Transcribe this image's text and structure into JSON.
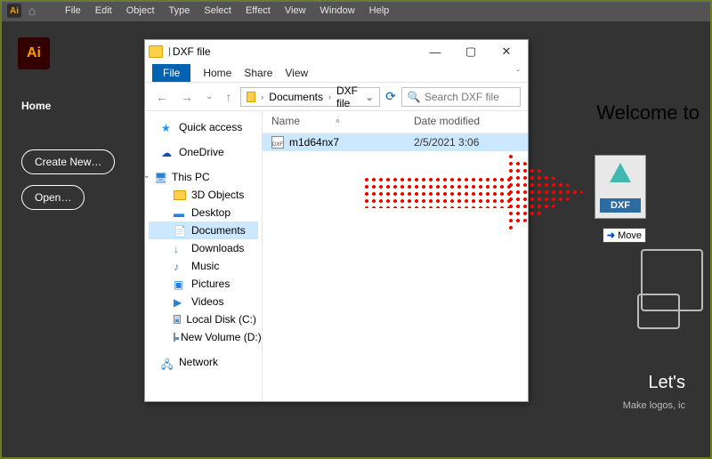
{
  "illustrator": {
    "brand_mark": "Ai",
    "menu": [
      "File",
      "Edit",
      "Object",
      "Type",
      "Select",
      "Effect",
      "View",
      "Window",
      "Help"
    ],
    "home_label": "Home",
    "create_new": "Create New…",
    "open": "Open…",
    "welcome": "Welcome to",
    "lets": "Let's",
    "subtitle": "Make logos, ic"
  },
  "drop_target": {
    "ext_label": "DXF",
    "tooltip_arrow": "➜",
    "tooltip_text": "Move"
  },
  "explorer": {
    "window_title": "DXF file",
    "ribbon": {
      "file": "File",
      "home": "Home",
      "share": "Share",
      "view": "View"
    },
    "breadcrumb": {
      "documents": "Documents",
      "folder": "DXF file"
    },
    "search_placeholder": "Search DXF file",
    "nav": {
      "quick_access": "Quick access",
      "onedrive": "OneDrive",
      "this_pc": "This PC",
      "children": [
        "3D Objects",
        "Desktop",
        "Documents",
        "Downloads",
        "Music",
        "Pictures",
        "Videos",
        "Local Disk (C:)",
        "New Volume (D:)"
      ],
      "network": "Network"
    },
    "columns": {
      "name": "Name",
      "date": "Date modified"
    },
    "file": {
      "name": "m1d64nx7",
      "date": "2/5/2021 3:06"
    }
  }
}
